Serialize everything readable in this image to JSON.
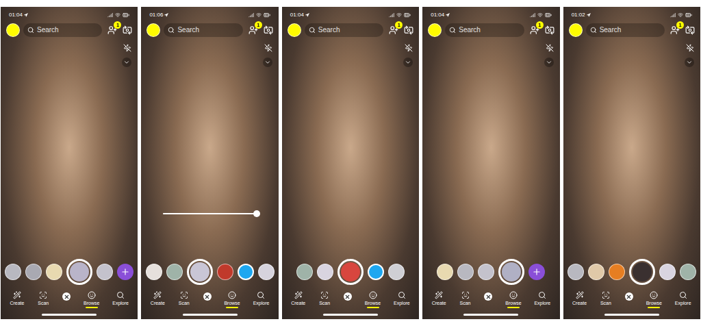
{
  "screens": [
    {
      "time": "01:04",
      "search": {
        "placeholder": "Search"
      },
      "badge": "1",
      "lenses": [
        {
          "kind": "lens",
          "color": "#b8b8c0"
        },
        {
          "kind": "lens",
          "color": "#a9a9b2"
        },
        {
          "kind": "lens",
          "color": "#e8d9b0"
        },
        {
          "kind": "selected",
          "color": "#b9b4c9"
        },
        {
          "kind": "lens",
          "color": "#c4c2cc"
        },
        {
          "kind": "add",
          "color": "#8a4fd8"
        }
      ]
    },
    {
      "time": "01:06",
      "search": {
        "placeholder": "Search"
      },
      "badge": "1",
      "slider": {
        "level": 1
      },
      "lenses": [
        {
          "kind": "lens",
          "color": "#e6e0dc"
        },
        {
          "kind": "lens",
          "color": "#9fb3a8"
        },
        {
          "kind": "selected",
          "color": "#c9c6d6"
        },
        {
          "kind": "lens",
          "color": "#c0392b"
        },
        {
          "kind": "capture",
          "color": "#1ea7f0"
        },
        {
          "kind": "lens",
          "color": "#d6d3dd"
        }
      ]
    },
    {
      "time": "01:04",
      "search": {
        "placeholder": "Search"
      },
      "badge": "1",
      "lenses": [
        {
          "kind": "lens",
          "color": "#9fb3a8"
        },
        {
          "kind": "lens",
          "color": "#d9d4e0"
        },
        {
          "kind": "selected",
          "color": "#d8463e"
        },
        {
          "kind": "capture",
          "color": "#1ea7f0"
        },
        {
          "kind": "lens",
          "color": "#cfcfd4"
        }
      ]
    },
    {
      "time": "01:04",
      "search": {
        "placeholder": "Search"
      },
      "badge": "1",
      "lenses": [
        {
          "kind": "lens",
          "color": "#e8d9b0"
        },
        {
          "kind": "lens",
          "color": "#b8b8c0"
        },
        {
          "kind": "lens",
          "color": "#c4c2cc"
        },
        {
          "kind": "selected",
          "color": "#b0b0c4"
        },
        {
          "kind": "add",
          "color": "#8a4fd8"
        }
      ]
    },
    {
      "time": "01:02",
      "search": {
        "placeholder": "Search"
      },
      "badge": "1",
      "lenses": [
        {
          "kind": "lens",
          "color": "#b8b8c0"
        },
        {
          "kind": "lens",
          "color": "#e0c9a8"
        },
        {
          "kind": "lens",
          "color": "#e67e22"
        },
        {
          "kind": "selected",
          "color": "#3a3030"
        },
        {
          "kind": "lens",
          "color": "#d9d4e0"
        },
        {
          "kind": "lens",
          "color": "#9fb3a8"
        }
      ]
    }
  ],
  "nav": [
    {
      "kind": "tab",
      "label": "Create",
      "selected": false
    },
    {
      "kind": "tab",
      "label": "Scan",
      "selected": false
    },
    {
      "kind": "close"
    },
    {
      "kind": "tab",
      "label": "Browse",
      "selected": true
    },
    {
      "kind": "tab",
      "label": "Explore",
      "selected": false
    }
  ]
}
